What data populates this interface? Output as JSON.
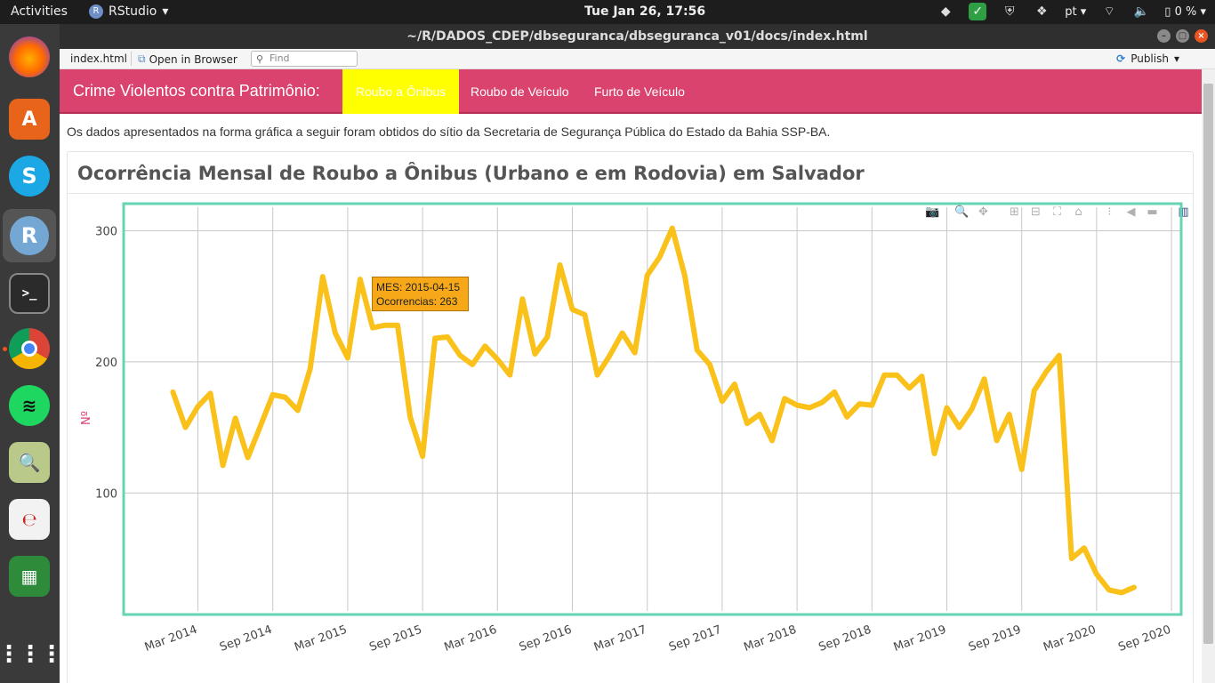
{
  "topbar": {
    "activities": "Activities",
    "app_name": "RStudio",
    "clock": "Tue Jan 26, 17:56",
    "keyboard": "pt",
    "battery": "0 %"
  },
  "dock": {
    "items": [
      "firefox-icon",
      "software-center-icon",
      "skype-icon",
      "rstudio-icon",
      "terminal-icon",
      "chrome-icon",
      "spotify-icon",
      "image-viewer-icon",
      "document-viewer-icon",
      "spreadsheet-icon",
      "app-grid-icon"
    ],
    "rstudio_letter": "R",
    "skype_letter": "S"
  },
  "window": {
    "title": "~/R/DADOS_CDEP/dbseguranca/dbseguranca_v01/docs/index.html"
  },
  "viewer_toolbar": {
    "file": "index.html",
    "open_in_browser": "Open in Browser",
    "find_placeholder": "Find",
    "publish": "Publish"
  },
  "navbar": {
    "brand": "Crime Violentos contra Patrimônio:",
    "links": [
      "Roubo a Ônibus",
      "Roubo de Veículo",
      "Furto de Veículo"
    ],
    "active_color": "#ffff00",
    "bar_color": "#d9436e"
  },
  "intro": "Os dados apresentados na forma gráfica a seguir foram obtidos do sítio da Secretaria de Segurança Pública do Estado da Bahia SSP-BA.",
  "card": {
    "title": "Ocorrência Mensal de Roubo a Ônibus (Urbano e em Rodovia) em Salvador"
  },
  "tooltip": {
    "line1": "MES: 2015-04-15",
    "line2": "Ocorrencias: 263"
  },
  "chart_data": {
    "type": "line",
    "ylabel": "Nº",
    "xlabel": "",
    "ylim": [
      10,
      318
    ],
    "yticks": [
      100,
      200,
      300
    ],
    "xticks": [
      "Mar 2014",
      "Sep 2014",
      "Mar 2015",
      "Sep 2015",
      "Mar 2016",
      "Sep 2016",
      "Mar 2017",
      "Sep 2017",
      "Mar 2018",
      "Sep 2018",
      "Mar 2019",
      "Sep 2019",
      "Mar 2020",
      "Sep 2020"
    ],
    "x_start": "2014-01",
    "line_color": "#f9c11a",
    "frame_color": "#66d4b4",
    "grid": true,
    "series": [
      {
        "values": [
          177,
          150,
          166,
          176,
          121,
          157,
          127,
          151,
          175,
          173,
          163,
          195,
          265,
          222,
          203,
          263,
          226,
          228,
          228,
          158,
          128,
          218,
          219,
          205,
          198,
          212,
          202,
          190,
          248,
          206,
          219,
          274,
          240,
          236,
          190,
          205,
          222,
          207,
          266,
          280,
          302,
          266,
          209,
          198,
          170,
          183,
          153,
          160,
          140,
          172,
          167,
          165,
          169,
          177,
          158,
          168,
          167,
          190,
          190,
          180,
          189,
          130,
          165,
          150,
          164,
          187,
          140,
          160,
          118,
          178,
          193,
          205,
          50,
          58,
          38,
          26,
          24,
          28
        ]
      }
    ]
  }
}
